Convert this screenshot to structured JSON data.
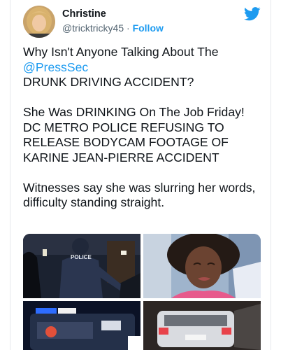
{
  "author": {
    "name": "Christine",
    "handle": "@tricktricky45",
    "separator": "·",
    "follow_label": "Follow"
  },
  "icons": {
    "platform": "twitter-bird-icon",
    "avatar": "avatar-image"
  },
  "tweet": {
    "p1_line1": "Why Isn't Anyone Talking About The",
    "p1_mention": "@PressSec",
    "p1_line3": "DRUNK DRIVING ACCIDENT?",
    "p2": "She Was DRINKING On The Job Friday! DC METRO POLICE REFUSING TO RELEASE BODYCAM FOOTAGE OF KARINE JEAN-PIERRE ACCIDENT",
    "p3": "Witnesses say she was slurring her words, difficulty standing straight."
  },
  "media": {
    "police_vest_text": "POLICE"
  },
  "colors": {
    "accent": "#1d9bf0",
    "text": "#0f1419",
    "secondary": "#536471"
  }
}
